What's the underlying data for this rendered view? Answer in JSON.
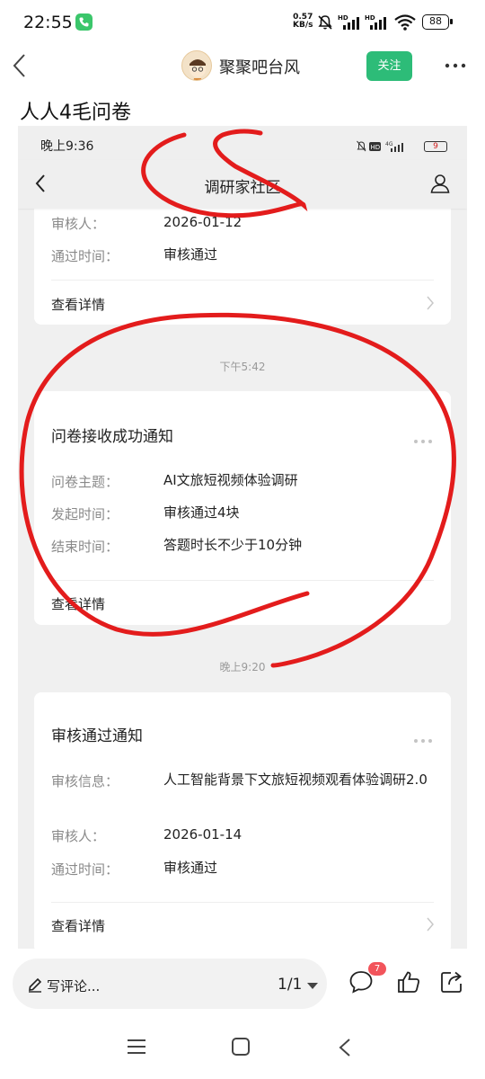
{
  "status_bar": {
    "time": "22:55",
    "net_speed_value": "0.57",
    "net_speed_unit": "KB/s",
    "battery": "88"
  },
  "header": {
    "title": "聚聚吧台风",
    "follow_label": "关注"
  },
  "post": {
    "title": "人人4毛问卷"
  },
  "screenshot": {
    "status_time": "晚上9:36",
    "battery": "9",
    "nav_title": "调研家社区",
    "card_top": {
      "rows": [
        {
          "label": "审核人：",
          "value": "2026-01-12"
        },
        {
          "label": "通过时间：",
          "value": "审核通过"
        }
      ],
      "detail_label": "查看详情"
    },
    "stamp1": "下午5:42",
    "card_mid": {
      "title": "问卷接收成功通知",
      "rows": [
        {
          "label": "问卷主题：",
          "value": "AI文旅短视频体验调研"
        },
        {
          "label": "发起时间：",
          "value": "审核通过4块"
        },
        {
          "label": "结束时间：",
          "value": "答题时长不少于10分钟"
        }
      ],
      "detail_label": "查看详情"
    },
    "stamp2": "晚上9:20",
    "card_bottom": {
      "title": "审核通过通知",
      "rows": [
        {
          "label": "审核信息：",
          "value": "人工智能背景下文旅短视频观看体验调研2.0"
        },
        {
          "label": "审核人：",
          "value": "2026-01-14"
        },
        {
          "label": "通过时间：",
          "value": "审核通过"
        }
      ],
      "detail_label": "查看详情"
    }
  },
  "comment_bar": {
    "placeholder": "写评论...",
    "page": "1/1",
    "comment_count": "7"
  },
  "colors": {
    "follow": "#2dbc78",
    "badge": "#f2545b",
    "annotation": "#e31c1c"
  },
  "icons": [
    "phone-icon",
    "mute-icon",
    "signal-icon",
    "wifi-icon",
    "back-icon",
    "more-icon",
    "user-icon",
    "chevron-right-icon",
    "pen-icon",
    "comment-icon",
    "like-icon",
    "share-icon",
    "menu-icon",
    "home-icon",
    "nav-back-icon"
  ]
}
